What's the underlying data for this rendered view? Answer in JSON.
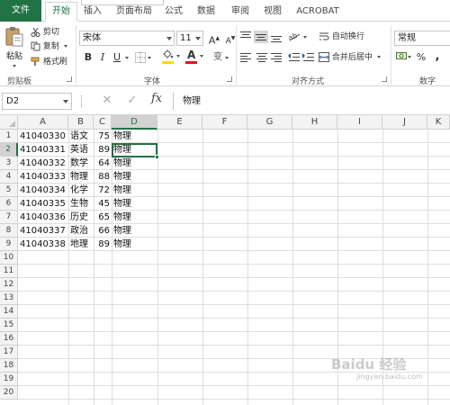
{
  "ribbon_tabs": {
    "file": "文件",
    "home": "开始",
    "insert": "插入",
    "page_layout": "页面布局",
    "formulas": "公式",
    "data": "数据",
    "review": "审阅",
    "view": "视图",
    "acrobat": "ACROBAT"
  },
  "clipboard": {
    "paste": "粘贴",
    "cut": "剪切",
    "copy": "复制",
    "format_painter": "格式刷",
    "group_label": "剪贴板"
  },
  "font": {
    "name": "宋体",
    "size": "11",
    "grow": "A",
    "shrink": "A",
    "bold": "B",
    "italic": "I",
    "underline": "U",
    "font_color_letter": "A",
    "phonetic": "变",
    "group_label": "字体",
    "font_color": "#e81123",
    "fill_color": "#ffd800"
  },
  "alignment": {
    "wrap_text": "自动换行",
    "merge_center": "合并后居中",
    "group_label": "对齐方式"
  },
  "number": {
    "format": "常规",
    "percent": "%",
    "comma": ",",
    "group_label": "数字"
  },
  "formula_bar": {
    "name_box": "D2",
    "fx": "fx",
    "content": "物理"
  },
  "grid": {
    "columns": [
      "A",
      "B",
      "C",
      "D",
      "E",
      "F",
      "G",
      "H",
      "I",
      "J",
      "K"
    ],
    "selected_column": "D",
    "selected_row": 2,
    "rows": [
      {
        "num": "1",
        "a": "41040330",
        "b": "语文",
        "c": "75",
        "d": "物理"
      },
      {
        "num": "2",
        "a": "41040331",
        "b": "英语",
        "c": "89",
        "d": "物理"
      },
      {
        "num": "3",
        "a": "41040332",
        "b": "数学",
        "c": "64",
        "d": "物理"
      },
      {
        "num": "4",
        "a": "41040333",
        "b": "物理",
        "c": "88",
        "d": "物理"
      },
      {
        "num": "5",
        "a": "41040334",
        "b": "化学",
        "c": "72",
        "d": "物理"
      },
      {
        "num": "6",
        "a": "41040335",
        "b": "生物",
        "c": "45",
        "d": "物理"
      },
      {
        "num": "7",
        "a": "41040336",
        "b": "历史",
        "c": "65",
        "d": "物理"
      },
      {
        "num": "8",
        "a": "41040337",
        "b": "政治",
        "c": "66",
        "d": "物理"
      },
      {
        "num": "9",
        "a": "41040338",
        "b": "地理",
        "c": "89",
        "d": "物理"
      }
    ],
    "empty_rows": [
      "10",
      "11",
      "12",
      "13",
      "14",
      "15",
      "16",
      "17",
      "18",
      "19",
      "20"
    ]
  },
  "watermark": {
    "text": "Baidu 经验",
    "sub": "jingyan.baidu.com"
  },
  "colors": {
    "excel_green": "#217346"
  }
}
